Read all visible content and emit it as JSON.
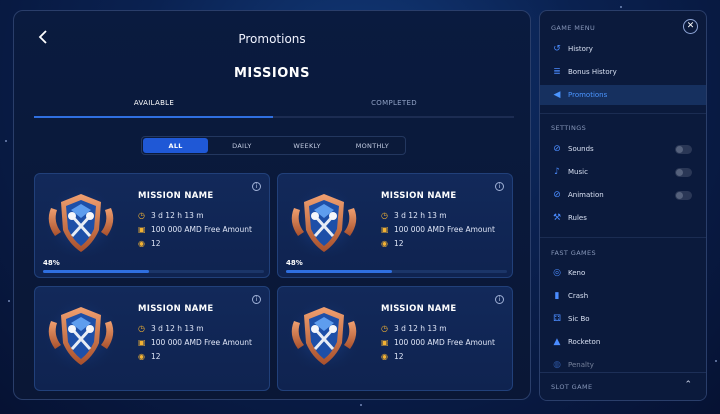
{
  "header": {
    "title": "Promotions",
    "back_icon": "chevron-left-icon"
  },
  "main": {
    "heading": "MISSIONS",
    "tabs": [
      {
        "label": "AVAILABLE",
        "active": true
      },
      {
        "label": "COMPLETED",
        "active": false
      }
    ],
    "filters": [
      {
        "label": "ALL",
        "active": true
      },
      {
        "label": "DAILY"
      },
      {
        "label": "WEEKLY"
      },
      {
        "label": "MONTHLY"
      }
    ],
    "cards": [
      {
        "name": "MISSION NAME",
        "time": "3 d 12 h 13 m",
        "reward": "100 000 AMD Free Amount",
        "games": "12",
        "progress_label": "48%",
        "progress": 0.48
      },
      {
        "name": "MISSION NAME",
        "time": "3 d 12 h 13 m",
        "reward": "100 000 AMD Free Amount",
        "games": "12",
        "progress_label": "48%",
        "progress": 0.48
      },
      {
        "name": "MISSION NAME",
        "time": "3 d 12 h 13 m",
        "reward": "100 000 AMD Free Amount",
        "games": "12"
      },
      {
        "name": "MISSION NAME",
        "time": "3 d 12 h 13 m",
        "reward": "100 000 AMD Free Amount",
        "games": "12"
      }
    ]
  },
  "sidebar": {
    "game_menu_label": "GAME MENU",
    "game_menu": [
      {
        "label": "History",
        "icon": "history-icon"
      },
      {
        "label": "Bonus History",
        "icon": "bonus-history-icon"
      },
      {
        "label": "Promotions",
        "icon": "megaphone-icon",
        "active": true
      }
    ],
    "settings_label": "SETTINGS",
    "settings": [
      {
        "label": "Sounds",
        "icon": "sound-muted-icon",
        "enabled": false
      },
      {
        "label": "Music",
        "icon": "music-muted-icon",
        "enabled": false
      },
      {
        "label": "Animation",
        "icon": "animation-muted-icon",
        "enabled": false
      },
      {
        "label": "Rules",
        "icon": "rules-hammer-icon"
      }
    ],
    "fast_games_label": "FAST GAMES",
    "fast_games": [
      {
        "label": "Keno",
        "icon": "keno-icon"
      },
      {
        "label": "Crash",
        "icon": "crash-chart-icon"
      },
      {
        "label": "Sic Bo",
        "icon": "dice-icon"
      },
      {
        "label": "Rocketon",
        "icon": "rocket-icon"
      },
      {
        "label": "Penalty",
        "icon": "penalty-icon"
      }
    ],
    "footer_label": "SLOT GAME"
  },
  "colors": {
    "accent": "#2f6fe0",
    "gold": "#f2b233",
    "active_text": "#4b95ff"
  }
}
